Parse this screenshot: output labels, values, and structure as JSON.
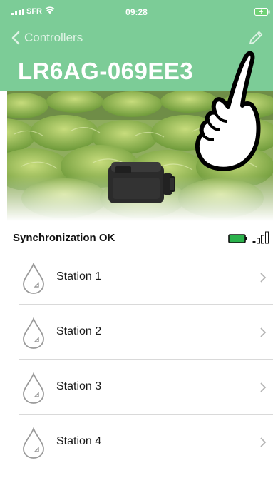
{
  "status_bar": {
    "carrier": "SFR",
    "time": "09:28"
  },
  "nav": {
    "back_label": "Controllers"
  },
  "controller": {
    "name": "LR6AG-069EE3"
  },
  "sync": {
    "label": "Synchronization OK"
  },
  "stations": [
    {
      "label": "Station 1"
    },
    {
      "label": "Station 2"
    },
    {
      "label": "Station 3"
    },
    {
      "label": "Station 4"
    }
  ],
  "colors": {
    "header": "#7ccc97",
    "battery": "#2bb24c",
    "icon_gray": "#9a9a9a"
  },
  "icons": [
    "signal-icon",
    "wifi-icon",
    "battery-icon",
    "back-chevron-icon",
    "pencil-icon",
    "water-drop-icon",
    "chevron-right-icon",
    "pointing-hand-icon"
  ]
}
